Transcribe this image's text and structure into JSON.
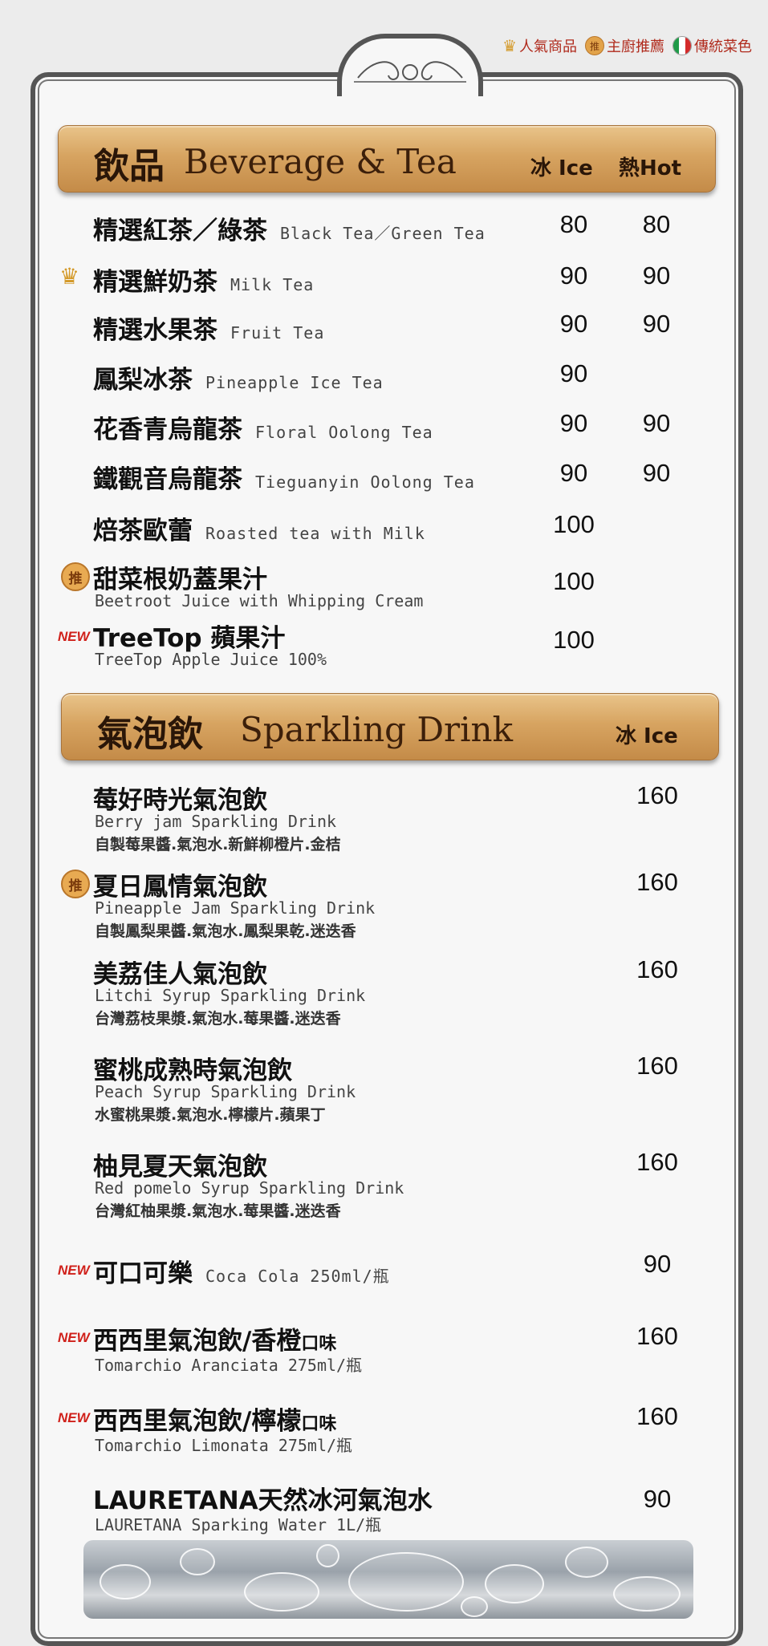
{
  "legend": {
    "popular": "人氣商品",
    "chef_tag": "推",
    "chef": "主廚推薦",
    "traditional": "傳統菜色"
  },
  "beverage": {
    "title_cn": "飲品",
    "title_en": "Beverage & Tea",
    "col_ice": "冰 Ice",
    "col_hot": "熱Hot",
    "items": [
      {
        "name": "精選紅茶／綠茶",
        "en": "Black Tea／Green Tea",
        "ice": "80",
        "hot": "80",
        "mark": ""
      },
      {
        "name": "精選鮮奶茶",
        "en": "Milk Tea",
        "ice": "90",
        "hot": "90",
        "mark": "crown"
      },
      {
        "name": "精選水果茶",
        "en": "Fruit Tea",
        "ice": "90",
        "hot": "90",
        "mark": ""
      },
      {
        "name": "鳳梨冰茶",
        "en": "Pineapple Ice Tea",
        "ice": "90",
        "hot": "",
        "mark": ""
      },
      {
        "name": "花香青烏龍茶",
        "en": "Floral Oolong Tea",
        "ice": "90",
        "hot": "90",
        "mark": ""
      },
      {
        "name": "鐵觀音烏龍茶",
        "en": "Tieguanyin Oolong Tea",
        "ice": "90",
        "hot": "90",
        "mark": ""
      },
      {
        "name": "焙茶歐蕾",
        "en": "Roasted tea with Milk",
        "ice": "100",
        "hot": "",
        "mark": ""
      },
      {
        "name": "甜菜根奶蓋果汁",
        "en": "Beetroot Juice with Whipping Cream",
        "ice": "100",
        "hot": "",
        "mark": "tui"
      },
      {
        "name": "TreeTop 蘋果汁",
        "en": "TreeTop Apple Juice 100%",
        "ice": "100",
        "hot": "",
        "mark": "new"
      }
    ]
  },
  "sparkling": {
    "title_cn": "氣泡飲",
    "title_en": "Sparkling Drink",
    "col_ice": "冰 Ice",
    "items": [
      {
        "name": "莓好時光氣泡飲",
        "en": "Berry jam Sparkling Drink",
        "desc": "自製莓果醬.氣泡水.新鮮柳橙片.金桔",
        "price": "160",
        "mark": ""
      },
      {
        "name": "夏日鳳情氣泡飲",
        "en": "Pineapple Jam Sparkling Drink",
        "desc": "自製鳳梨果醬.氣泡水.鳳梨果乾.迷迭香",
        "price": "160",
        "mark": "tui"
      },
      {
        "name": "美荔佳人氣泡飲",
        "en": "Litchi Syrup Sparkling Drink",
        "desc": "台灣荔枝果漿.氣泡水.莓果醬.迷迭香",
        "price": "160",
        "mark": ""
      },
      {
        "name": "蜜桃成熟時氣泡飲",
        "en": "Peach Syrup Sparkling Drink",
        "desc": "水蜜桃果漿.氣泡水.檸檬片.蘋果丁",
        "price": "160",
        "mark": ""
      },
      {
        "name": "柚見夏天氣泡飲",
        "en": "Red pomelo Syrup Sparkling Drink",
        "desc": "台灣紅柚果漿.氣泡水.莓果醬.迷迭香",
        "price": "160",
        "mark": ""
      },
      {
        "name": "可口可樂",
        "en": "Coca Cola 250ml/瓶",
        "desc": "",
        "price": "90",
        "mark": "new"
      },
      {
        "name": "西西里氣泡飲/香橙",
        "name_small": "口味",
        "en": "Tomarchio Aranciata 275ml/瓶",
        "desc": "",
        "price": "160",
        "mark": "new"
      },
      {
        "name": "西西里氣泡飲/檸檬",
        "name_small": "口味",
        "en": "Tomarchio Limonata 275ml/瓶",
        "desc": "",
        "price": "160",
        "mark": "new"
      },
      {
        "name": "LAURETANA天然冰河氣泡水",
        "en": "LAURETANA Sparking Water 1L/瓶",
        "desc": "",
        "price": "90",
        "mark": ""
      }
    ]
  },
  "marks": {
    "new": "NEW",
    "tui": "推",
    "crown": "♛"
  }
}
